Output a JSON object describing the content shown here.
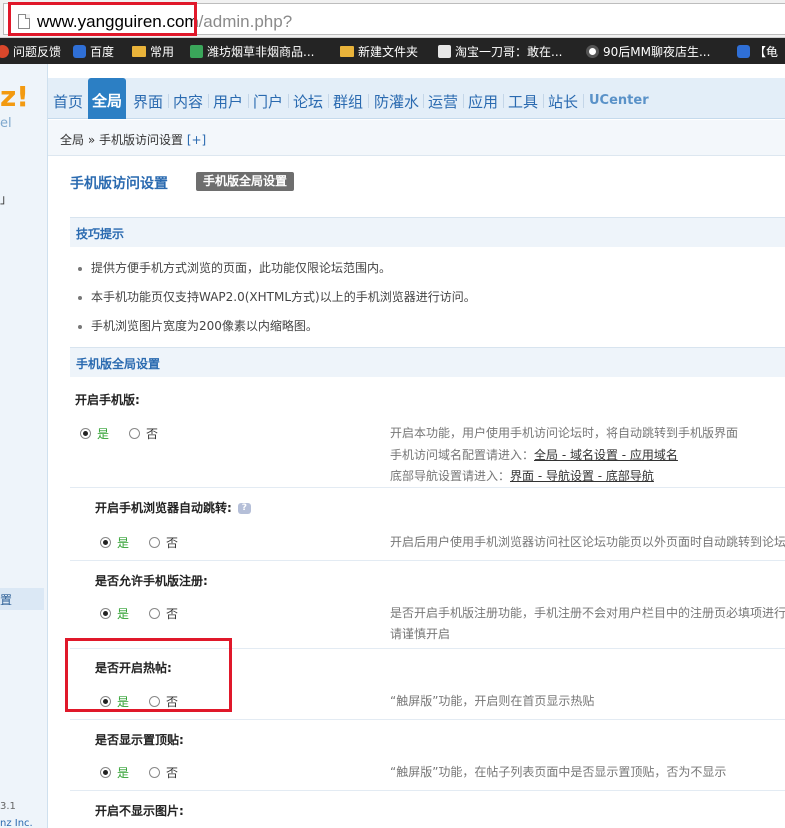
{
  "browser": {
    "url_domain": "www.yangguiren.com",
    "url_path": "/admin.php?"
  },
  "bookmarks": [
    {
      "label": "问题反馈",
      "icon": "feedback-icon"
    },
    {
      "label": "百度",
      "icon": "baidu-paw-icon"
    },
    {
      "label": "常用",
      "icon": "folder-icon"
    },
    {
      "label": "潍坊烟草非烟商品...",
      "icon": "site-icon"
    },
    {
      "label": "新建文件夹",
      "icon": "folder-icon"
    },
    {
      "label": "淘宝一刀哥：敢在...",
      "icon": "page-icon"
    },
    {
      "label": "90后MM聊夜店生...",
      "icon": "clock-icon"
    },
    {
      "label": "【龟",
      "icon": "baidu-paw-icon"
    }
  ],
  "sidebar": {
    "logo": "z!",
    "logo_sub": "el",
    "fragment_top": "」",
    "active_item": "置",
    "version": "3.1",
    "company": "nz Inc."
  },
  "nav": {
    "tabs": [
      "首页",
      "全局",
      "界面",
      "内容",
      "用户",
      "门户",
      "论坛",
      "群组",
      "防灌水",
      "运营",
      "应用",
      "工具",
      "站长",
      "UCenter"
    ],
    "active_index": 1
  },
  "breadcrumb": {
    "path": "全局 » 手机版访问设置",
    "plus": "[+]"
  },
  "page": {
    "title": "手机版访问设置",
    "badge": "手机版全局设置"
  },
  "tips": {
    "heading": "技巧提示",
    "items": [
      "提供方便手机方式浏览的页面，此功能仅限论坛范围内。",
      "本手机功能页仅支持WAP2.0(XHTML方式)以上的手机浏览器进行访问。",
      "手机浏览图片宽度为200像素以内缩略图。"
    ]
  },
  "settings": {
    "heading": "手机版全局设置",
    "yes": "是",
    "no": "否",
    "rows": [
      {
        "label": "开启手机版:",
        "value": "是",
        "desc_lines": [
          "开启本功能，用户使用手机访问论坛时，将自动跳转到手机版界面"
        ],
        "desc_line2_prefix": "手机访问域名配置请进入：",
        "desc_line2_link": "全局 - 域名设置 - 应用域名",
        "desc_line3_prefix": "底部导航设置请进入：",
        "desc_line3_link": "界面 - 导航设置 - 底部导航"
      },
      {
        "label": "开启手机浏览器自动跳转:",
        "value": "是",
        "desc": "开启后用户使用手机浏览器访问社区论坛功能页以外页面时自动跳转到论坛"
      },
      {
        "label": "是否允许手机版注册:",
        "value": "是",
        "desc": "是否开启手机版注册功能，手机注册不会对用户栏目中的注册页必填项进行",
        "desc2": "请谨慎开启"
      },
      {
        "label": "是否开启热帖:",
        "value": "是",
        "desc": "“触屏版”功能，开启则在首页显示热贴"
      },
      {
        "label": "是否显示置顶贴:",
        "value": "是",
        "desc": "“触屏版”功能，在帖子列表页面中是否显示置顶贴，否为不显示"
      },
      {
        "label": "开启不显示图片:"
      }
    ]
  },
  "colors": {
    "accent": "#2a6ab0",
    "active_tab": "#2c7fc4",
    "yes_green": "#2ea030",
    "highlight_red": "#e0182a"
  }
}
